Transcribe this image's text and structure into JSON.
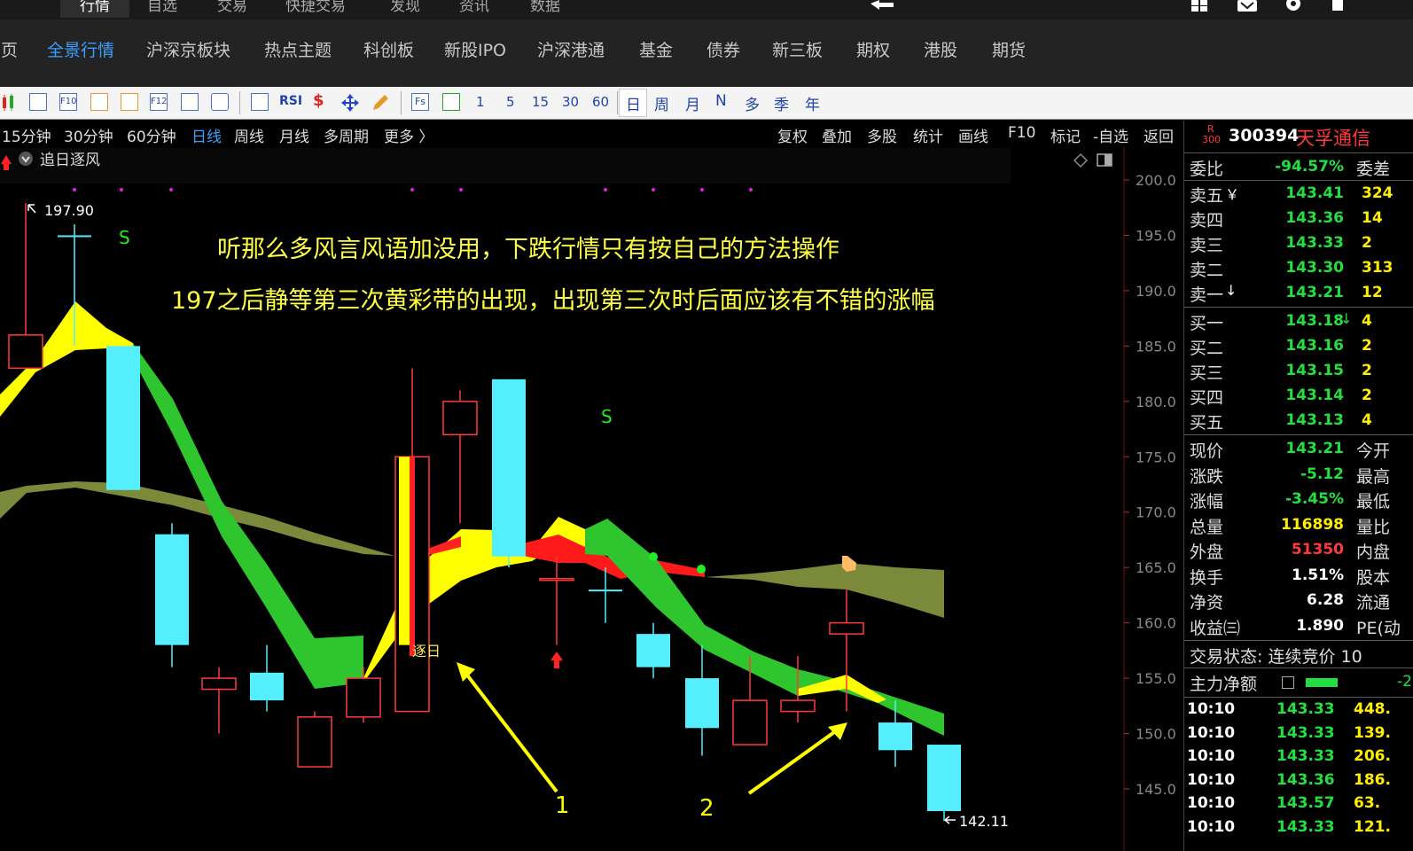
{
  "top_menu": [
    "行情",
    "自选",
    "交易",
    "快捷交易",
    "发现",
    "资讯",
    "数据"
  ],
  "tabs": [
    "首页",
    "全景行情",
    "沪深京板块",
    "热点主题",
    "科创板",
    "新股IPO",
    "沪深港通",
    "基金",
    "债券",
    "新三板",
    "期权",
    "港股",
    "期货"
  ],
  "toolbar": {
    "icon_names": [
      "candle-icon",
      "list-icon",
      "f10-icon",
      "doc-icon",
      "notebook-icon",
      "f12-icon",
      "formula-icon",
      "circle-icon",
      "wave-icon",
      "rsi-icon",
      "money-icon",
      "move-icon",
      "pencil-icon",
      "fs-icon",
      "refresh-icon"
    ],
    "rsi_label": "RSI",
    "fs_label": "Fs",
    "f10_label": "F10",
    "f12_label": "F12",
    "minutes": [
      "1",
      "5",
      "15",
      "30",
      "60"
    ],
    "periods": [
      "日",
      "周",
      "月",
      "N",
      "多",
      "季",
      "年"
    ]
  },
  "period_bar": {
    "left": [
      "15分钟",
      "30分钟",
      "60分钟",
      "日线",
      "周线",
      "月线",
      "多周期",
      "更多 〉"
    ],
    "active": "日线",
    "right": [
      "复权",
      "叠加",
      "多股",
      "统计",
      "画线",
      "F10",
      "标记",
      "-自选",
      "返回"
    ]
  },
  "indicator_title": "追日逐风",
  "annotations": {
    "line1": "听那么多风言风语加没用，下跌行情只有按自己的方法操作",
    "line2": "197之后静等第三次黄彩带的出现，出现第三次时后面应该有不错的涨幅",
    "high_label": "197.90",
    "low_label": "142.11",
    "signal_s": "S",
    "zhuri": "逐日",
    "arrow1": "1",
    "arrow2": "2"
  },
  "chart_data": {
    "type": "candlestick",
    "y_ticks": [
      "200.0",
      "195.0",
      "190.0",
      "185.0",
      "180.0",
      "175.0",
      "170.0",
      "165.0",
      "160.0",
      "155.0",
      "150.0",
      "145.0"
    ],
    "ylim": [
      142.5,
      200.0
    ],
    "candles": [
      {
        "o": 186,
        "c": 183,
        "h": 197.9,
        "l": 183,
        "color": "red"
      },
      {
        "o": 195,
        "c": 195,
        "h": 196,
        "l": 185,
        "color": "cyan"
      },
      {
        "o": 185,
        "c": 172,
        "h": 185,
        "l": 172,
        "color": "cyan"
      },
      {
        "o": 168,
        "c": 158,
        "h": 169,
        "l": 156,
        "color": "cyan"
      },
      {
        "o": 154,
        "c": 155,
        "h": 156,
        "l": 150,
        "color": "red"
      },
      {
        "o": 155.5,
        "c": 153,
        "h": 158,
        "l": 152,
        "color": "cyan"
      },
      {
        "o": 147,
        "c": 151.5,
        "h": 152,
        "l": 147,
        "color": "red"
      },
      {
        "o": 151.5,
        "c": 155,
        "h": 156,
        "l": 151,
        "color": "red"
      },
      {
        "o": 152,
        "c": 175,
        "h": 183,
        "l": 152,
        "color": "red"
      },
      {
        "o": 177,
        "c": 180,
        "h": 181,
        "l": 169,
        "color": "red"
      },
      {
        "o": 182,
        "c": 166,
        "h": 182,
        "l": 165,
        "color": "cyan"
      },
      {
        "o": 164,
        "c": 164,
        "h": 166,
        "l": 158,
        "color": "red"
      },
      {
        "o": 163,
        "c": 163,
        "h": 165,
        "l": 160,
        "color": "cyan"
      },
      {
        "o": 159,
        "c": 156,
        "h": 160,
        "l": 155,
        "color": "cyan"
      },
      {
        "o": 155,
        "c": 150.5,
        "h": 158,
        "l": 148,
        "color": "cyan"
      },
      {
        "o": 149,
        "c": 153,
        "h": 157,
        "l": 149,
        "color": "red"
      },
      {
        "o": 152,
        "c": 153,
        "h": 157,
        "l": 151,
        "color": "red"
      },
      {
        "o": 159,
        "c": 160,
        "h": 163,
        "l": 152,
        "color": "red"
      },
      {
        "o": 151,
        "c": 148.5,
        "h": 153,
        "l": 147,
        "color": "cyan"
      },
      {
        "o": 149,
        "c": 143,
        "h": 149,
        "l": 142.11,
        "color": "cyan"
      }
    ]
  },
  "stock": {
    "badge_top": "R",
    "badge_bottom": "300",
    "code": "300394",
    "name": "天孚通信"
  },
  "order_book": {
    "weibi_label": "委比",
    "weibi_value": "-94.57%",
    "weicha_label": "委差",
    "sell": [
      {
        "label": "卖五",
        "extra": "￥",
        "price": "143.41",
        "vol": "324"
      },
      {
        "label": "卖四",
        "extra": "",
        "price": "143.36",
        "vol": "14"
      },
      {
        "label": "卖三",
        "extra": "",
        "price": "143.33",
        "vol": "2"
      },
      {
        "label": "卖二",
        "extra": "",
        "price": "143.30",
        "vol": "313"
      },
      {
        "label": "卖一",
        "extra": "↓",
        "price": "143.21",
        "vol": "12"
      }
    ],
    "buy": [
      {
        "label": "买一",
        "extra": "↓",
        "price": "143.18",
        "vol": "4"
      },
      {
        "label": "买二",
        "extra": "",
        "price": "143.16",
        "vol": "2"
      },
      {
        "label": "买三",
        "extra": "",
        "price": "143.15",
        "vol": "2"
      },
      {
        "label": "买四",
        "extra": "",
        "price": "143.14",
        "vol": "2"
      },
      {
        "label": "买五",
        "extra": "",
        "price": "143.13",
        "vol": "4"
      }
    ]
  },
  "quote": [
    {
      "label": "现价",
      "value": "143.21",
      "color": "green",
      "ext": "今开"
    },
    {
      "label": "涨跌",
      "value": "-5.12",
      "color": "green",
      "ext": "最高"
    },
    {
      "label": "涨幅",
      "value": "-3.45%",
      "color": "green",
      "ext": "最低"
    },
    {
      "label": "总量",
      "value": "116898",
      "color": "yellow",
      "ext": "量比"
    },
    {
      "label": "外盘",
      "value": "51350",
      "color": "red",
      "ext": "内盘"
    },
    {
      "label": "换手",
      "value": "1.51%",
      "color": "white",
      "ext": "股本"
    },
    {
      "label": "净资",
      "value": "6.28",
      "color": "white",
      "ext": "流通"
    },
    {
      "label": "收益㈢",
      "value": "1.890",
      "color": "white",
      "ext": "PE(动"
    }
  ],
  "status": {
    "trade_label": "交易状态: 连续竞价 10",
    "net_label": "主力净额",
    "net_value": "-2"
  },
  "ticks": [
    {
      "time": "10:10",
      "price": "143.33",
      "vol": "448."
    },
    {
      "time": "10:10",
      "price": "143.33",
      "vol": "139."
    },
    {
      "time": "10:10",
      "price": "143.33",
      "vol": "206."
    },
    {
      "time": "10:10",
      "price": "143.36",
      "vol": "186."
    },
    {
      "time": "10:10",
      "price": "143.57",
      "vol": "63."
    },
    {
      "time": "10:10",
      "price": "143.33",
      "vol": "121."
    }
  ],
  "colors": {
    "up": "#ff3a3a",
    "down": "#55eeff",
    "green_band": "#2ec52e",
    "yellow_band": "#ffff00",
    "olive_band": "#7a8a3a",
    "accent": "#3aa0ff"
  }
}
